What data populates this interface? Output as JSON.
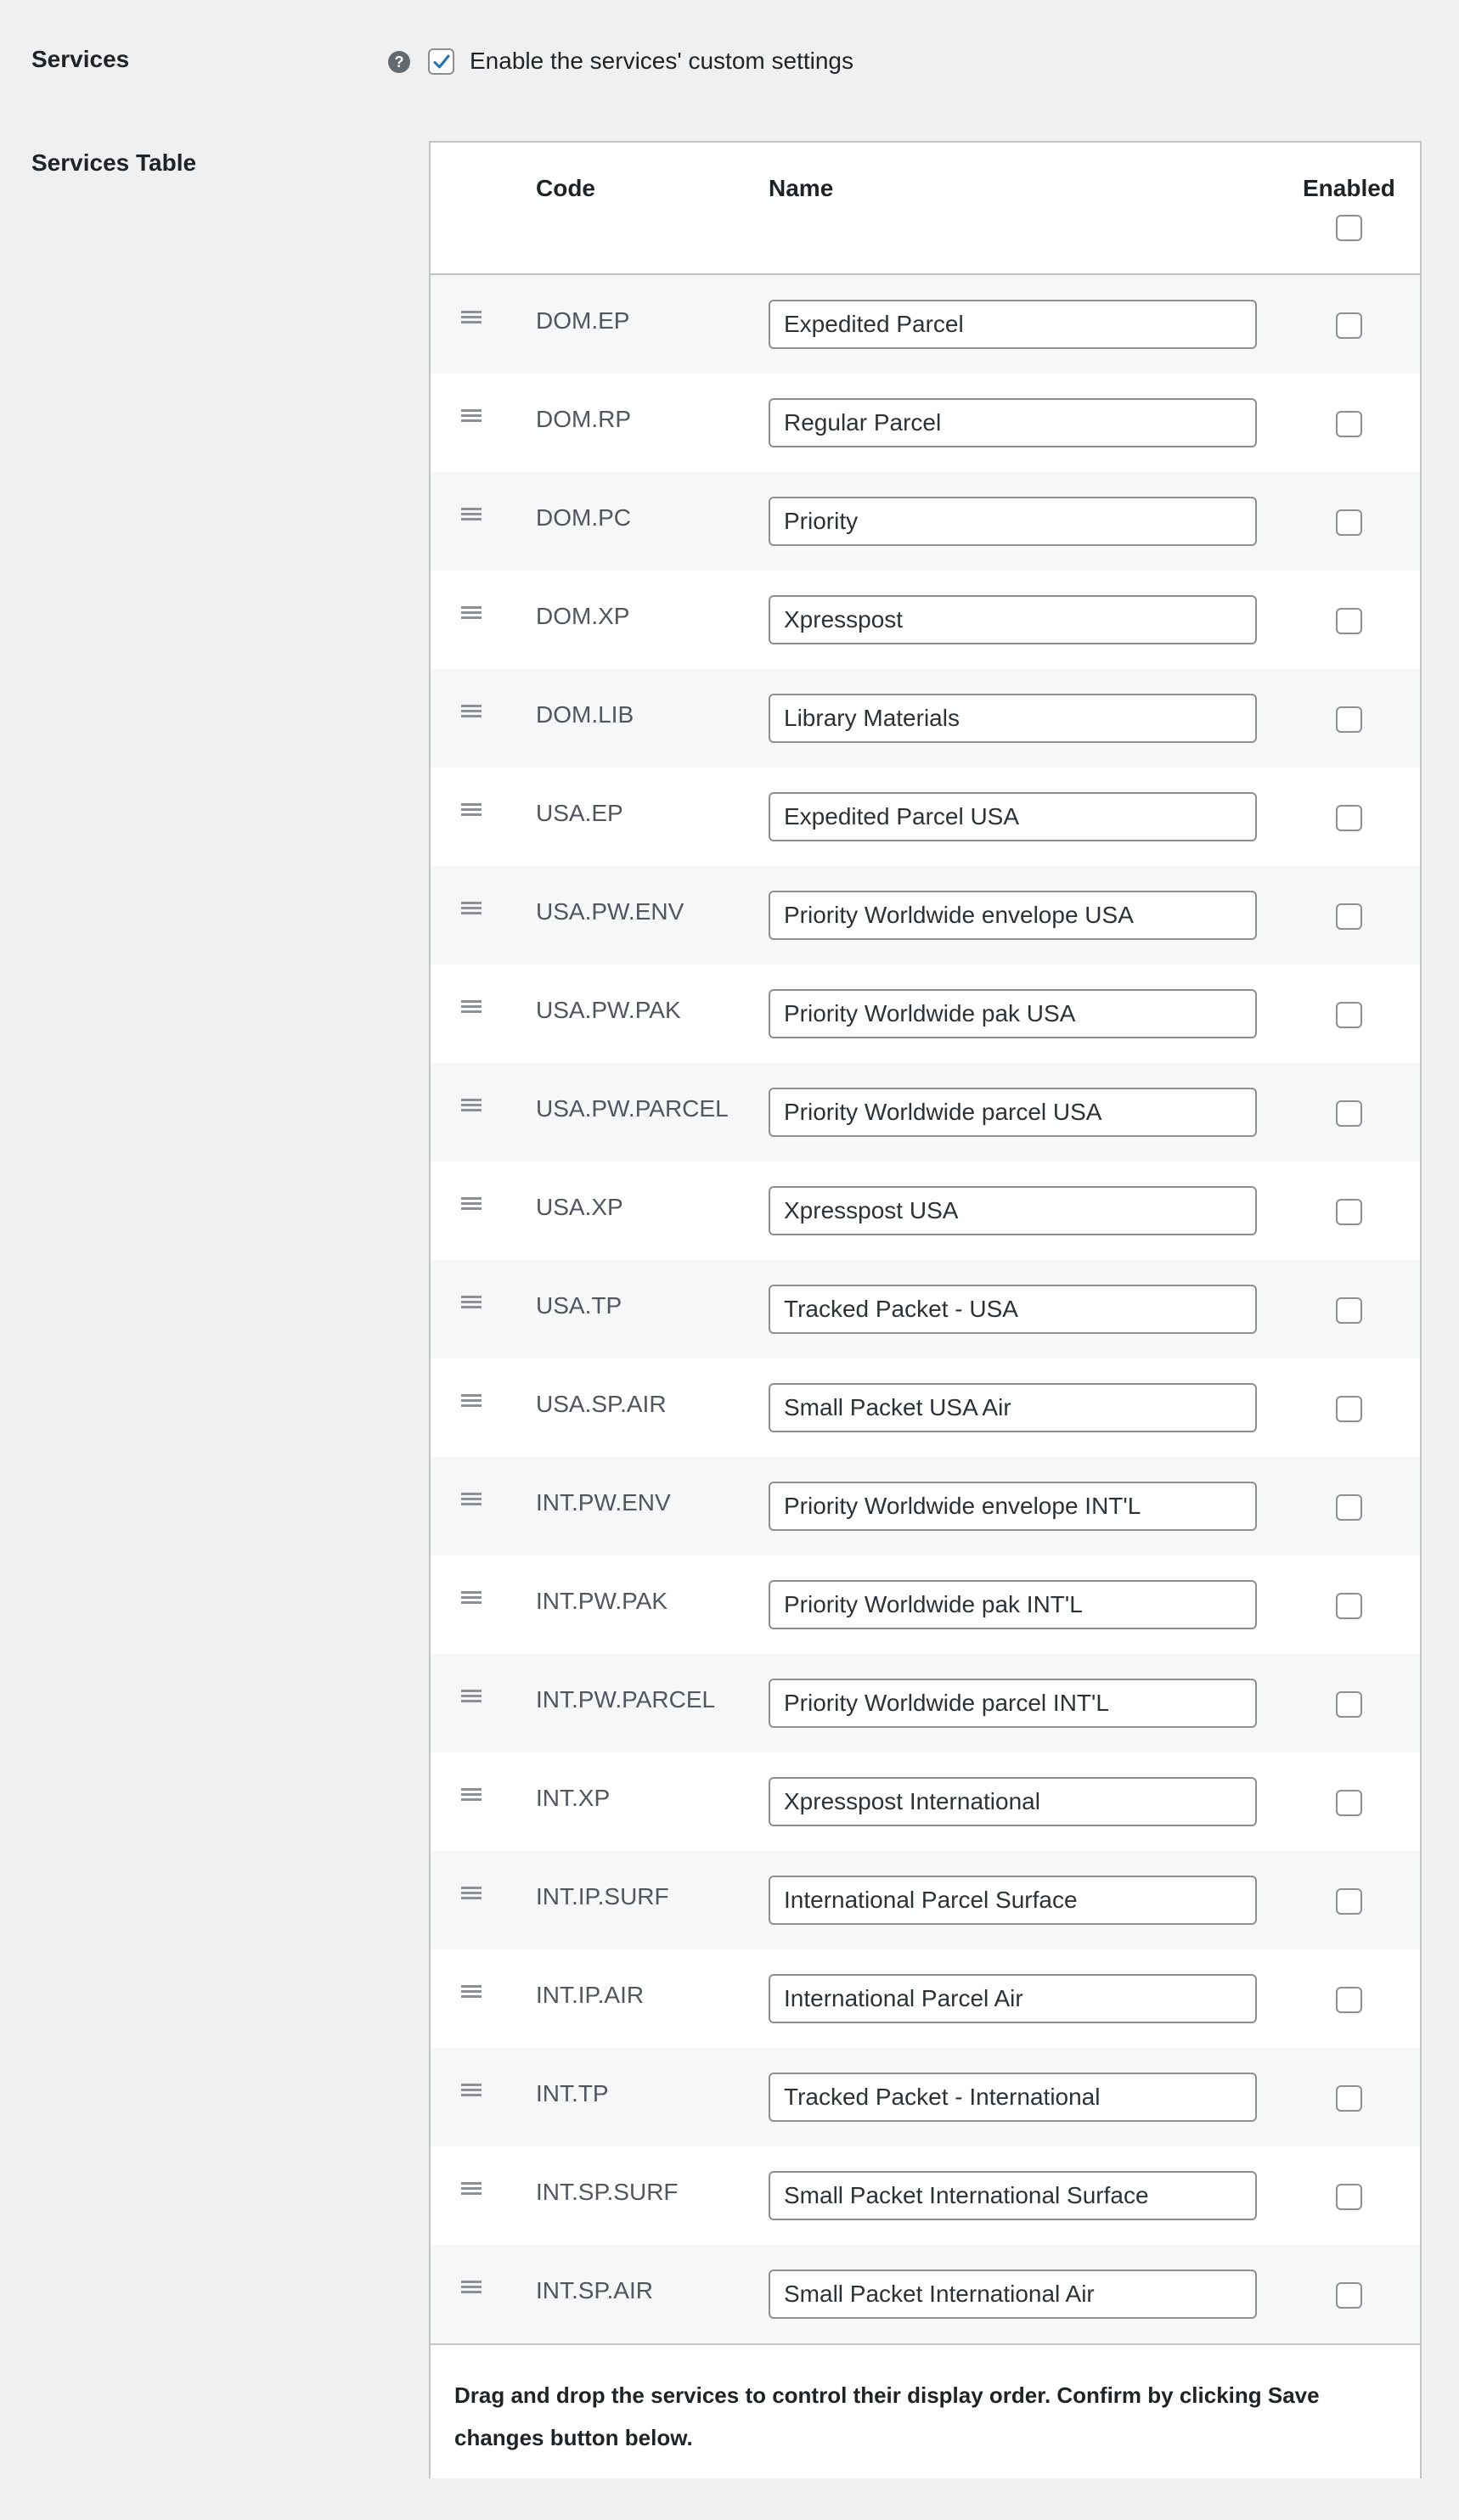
{
  "settings": {
    "services_label": "Services",
    "services_help_icon": "question-mark-icon",
    "enable_custom_label": "Enable the services' custom settings",
    "enable_custom_checked": true,
    "services_table_label": "Services Table"
  },
  "table": {
    "headers": {
      "code": "Code",
      "name": "Name",
      "enabled": "Enabled"
    },
    "rows": [
      {
        "code": "DOM.EP",
        "name": "Expedited Parcel",
        "enabled": false
      },
      {
        "code": "DOM.RP",
        "name": "Regular Parcel",
        "enabled": false
      },
      {
        "code": "DOM.PC",
        "name": "Priority",
        "enabled": false
      },
      {
        "code": "DOM.XP",
        "name": "Xpresspost",
        "enabled": false
      },
      {
        "code": "DOM.LIB",
        "name": "Library Materials",
        "enabled": false
      },
      {
        "code": "USA.EP",
        "name": "Expedited Parcel USA",
        "enabled": false
      },
      {
        "code": "USA.PW.ENV",
        "name": "Priority Worldwide envelope USA",
        "enabled": false
      },
      {
        "code": "USA.PW.PAK",
        "name": "Priority Worldwide pak USA",
        "enabled": false
      },
      {
        "code": "USA.PW.PARCEL",
        "name": "Priority Worldwide parcel USA",
        "enabled": false
      },
      {
        "code": "USA.XP",
        "name": "Xpresspost USA",
        "enabled": false
      },
      {
        "code": "USA.TP",
        "name": "Tracked Packet - USA",
        "enabled": false
      },
      {
        "code": "USA.SP.AIR",
        "name": "Small Packet USA Air",
        "enabled": false
      },
      {
        "code": "INT.PW.ENV",
        "name": "Priority Worldwide envelope INT'L",
        "enabled": false
      },
      {
        "code": "INT.PW.PAK",
        "name": "Priority Worldwide pak INT'L",
        "enabled": false
      },
      {
        "code": "INT.PW.PARCEL",
        "name": "Priority Worldwide parcel INT'L",
        "enabled": false
      },
      {
        "code": "INT.XP",
        "name": "Xpresspost International",
        "enabled": false
      },
      {
        "code": "INT.IP.SURF",
        "name": "International Parcel Surface",
        "enabled": false
      },
      {
        "code": "INT.IP.AIR",
        "name": "International Parcel Air",
        "enabled": false
      },
      {
        "code": "INT.TP",
        "name": "Tracked Packet - International",
        "enabled": false
      },
      {
        "code": "INT.SP.SURF",
        "name": "Small Packet International Surface",
        "enabled": false
      },
      {
        "code": "INT.SP.AIR",
        "name": "Small Packet International Air",
        "enabled": false
      }
    ],
    "footer_note": "Drag and drop the services to control their display order. Confirm by clicking Save changes button below."
  },
  "colors": {
    "accent": "#2271b1",
    "page_background": "#f0f0f1",
    "border": "#c3c4c7"
  }
}
